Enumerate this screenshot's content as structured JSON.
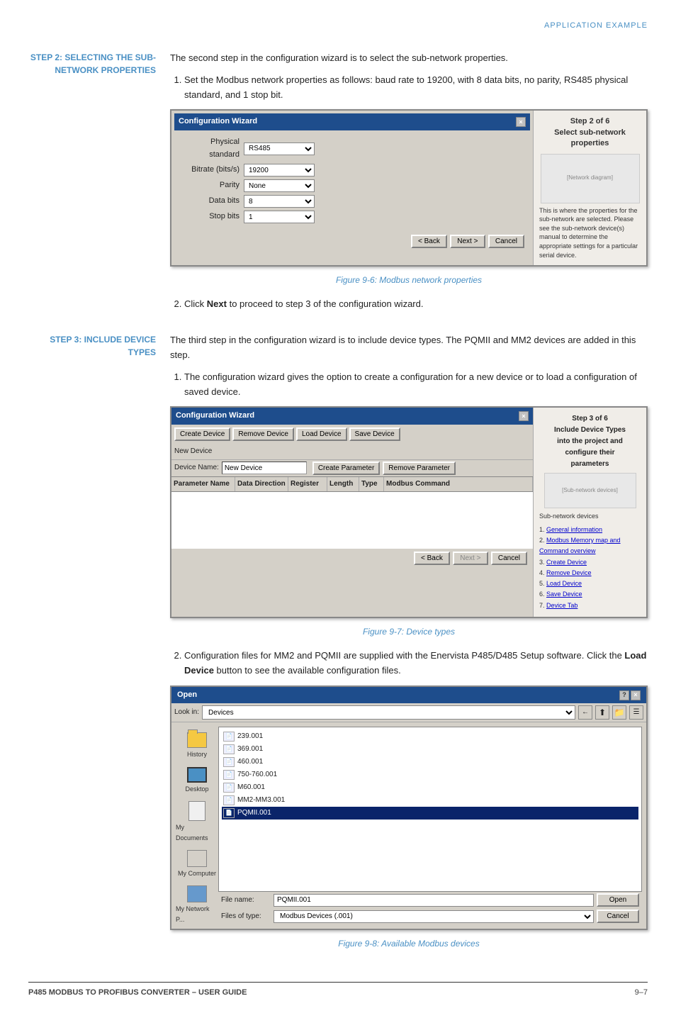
{
  "header": {
    "text": "APPLICATION EXAMPLE"
  },
  "section2": {
    "label": "STEP 2: SELECTING THE SUB-NETWORK PROPERTIES",
    "intro": "The second step in the configuration wizard is to select the sub-network properties.",
    "step1": "Set the Modbus network properties as follows: baud rate to 19200, with 8 data bits, no parity, RS485 physical standard, and 1 stop bit.",
    "step2": "Click Next to proceed to step 3 of the configuration wizard.",
    "dialog_title": "Configuration Wizard",
    "close_x": "×",
    "fields": [
      {
        "label": "Physical standard",
        "value": "RS485"
      },
      {
        "label": "Bitrate (bits/s)",
        "value": "19200"
      },
      {
        "label": "Parity",
        "value": "None"
      },
      {
        "label": "Data bits",
        "value": "8"
      },
      {
        "label": "Stop bits",
        "value": "1"
      }
    ],
    "buttons": [
      "< Back",
      "Next >",
      "Cancel"
    ],
    "step_title": "Step 2 of 6\nSelect sub-network\nproperties",
    "figure_caption": "Figure 9-6: Modbus network properties"
  },
  "section3": {
    "label": "STEP 3: INCLUDE DEVICE TYPES",
    "intro": "The third step in the configuration wizard is to include device types. The PQMII and MM2 devices are added in this step.",
    "step1": "The configuration wizard gives the option to create a configuration for a new device or to load a configuration of saved device.",
    "dialog_title": "Configuration Wizard",
    "toolbar_buttons": [
      "Create Device",
      "Remove Device",
      "Load Device",
      "Save Device"
    ],
    "new_device_label": "New Device",
    "device_name_label": "Device Name",
    "device_name_value": "New Device",
    "create_param_btn": "Create Parameter",
    "remove_param_btn": "Remove Parameter",
    "table_headers": [
      "Parameter Name",
      "Data Direction",
      "Register",
      "Length",
      "Type",
      "Modbus Command"
    ],
    "buttons_bottom": [
      "< Back",
      "Next >",
      "Cancel"
    ],
    "step_title": "Step 3 of 6\nInclude Device Types\ninto the project and\nconfigure their\nparameters",
    "sub_devices_label": "Sub-network devices",
    "links": [
      "1. General information",
      "2. Modbus Memory map and Command overview",
      "3. Create Device",
      "4. Remove Device",
      "5. Load Device",
      "6. Save Device",
      "7. Device Tab"
    ],
    "figure_caption": "Figure 9-7: Device types",
    "step2_text": "Configuration files for MM2 and PQMII are supplied with the Enervista P485/D485 Setup software. Click the Load Device button to see the available configuration files."
  },
  "open_dialog": {
    "title": "Open",
    "dialog_id": "?",
    "close_x": "×",
    "lookin_label": "Look in:",
    "lookin_value": "Devices",
    "toolbar_buttons": [
      "←",
      "📁",
      "🗂",
      "☰"
    ],
    "sidebar_items": [
      "History",
      "Desktop",
      "My Documents",
      "My Computer",
      "My Network P..."
    ],
    "files": [
      "239.001",
      "369.001",
      "460.001",
      "750-760.001",
      "M60.001",
      "MM2-MM3.001",
      "PQMII.001"
    ],
    "selected_file": "PQMII.001",
    "filename_label": "File name:",
    "filename_value": "PQMII.001",
    "filetype_label": "Files of type:",
    "filetype_value": "Modbus Devices (.001)",
    "open_btn": "Open",
    "cancel_btn": "Cancel",
    "figure_caption": "Figure 9-8: Available Modbus devices"
  },
  "footer": {
    "left": "P485 MODBUS TO PROFIBUS CONVERTER – USER GUIDE",
    "right": "9–7"
  }
}
